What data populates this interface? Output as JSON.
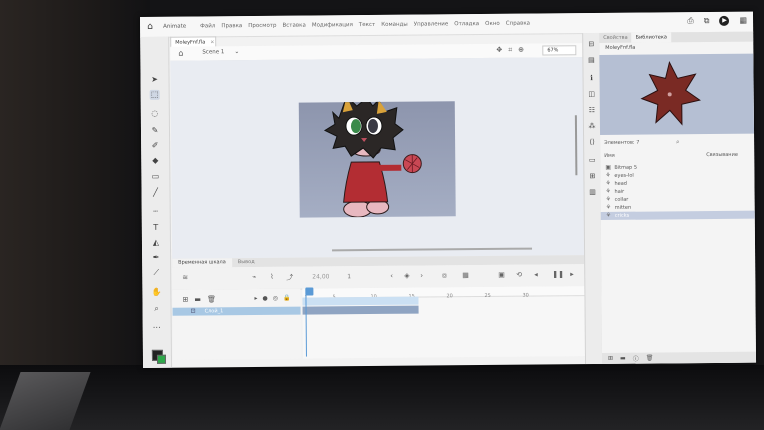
{
  "menubar": {
    "app_name": "Animate",
    "items": [
      "Файл",
      "Правка",
      "Просмотр",
      "Вставка",
      "Модификация",
      "Текст",
      "Команды",
      "Управление",
      "Отладка",
      "Окно",
      "Справка"
    ]
  },
  "document": {
    "tab_name": "MoleyFnf.fla"
  },
  "scenebar": {
    "scene_label": "Scene 1",
    "zoom": "67%"
  },
  "panels": {
    "right_tabs": [
      "Свойства",
      "Библиотека"
    ],
    "library_file": "MoleyFnf.fla",
    "count_label": "Элементов: 7",
    "header_name": "Имя",
    "header_links": "Связывание",
    "library_items": [
      {
        "name": "Bitmap 5",
        "selected": false
      },
      {
        "name": "eyes-lol",
        "selected": false
      },
      {
        "name": "head",
        "selected": false
      },
      {
        "name": "hair",
        "selected": false
      },
      {
        "name": "collar",
        "selected": false
      },
      {
        "name": "mitten",
        "selected": false
      },
      {
        "name": "cricks",
        "selected": false
      }
    ]
  },
  "timeline": {
    "tabs": [
      "Временная шкала",
      "Вывод"
    ],
    "fps": "24,00",
    "frame": "1",
    "layer_name": "Слой_1",
    "ruler_ticks": [
      "1",
      "5",
      "10",
      "15",
      "20",
      "25",
      "30"
    ]
  },
  "colors": {
    "stage_bg": "#a5aec4",
    "selection": "#a8c8e4",
    "accent_blue": "#5a9ad6"
  }
}
